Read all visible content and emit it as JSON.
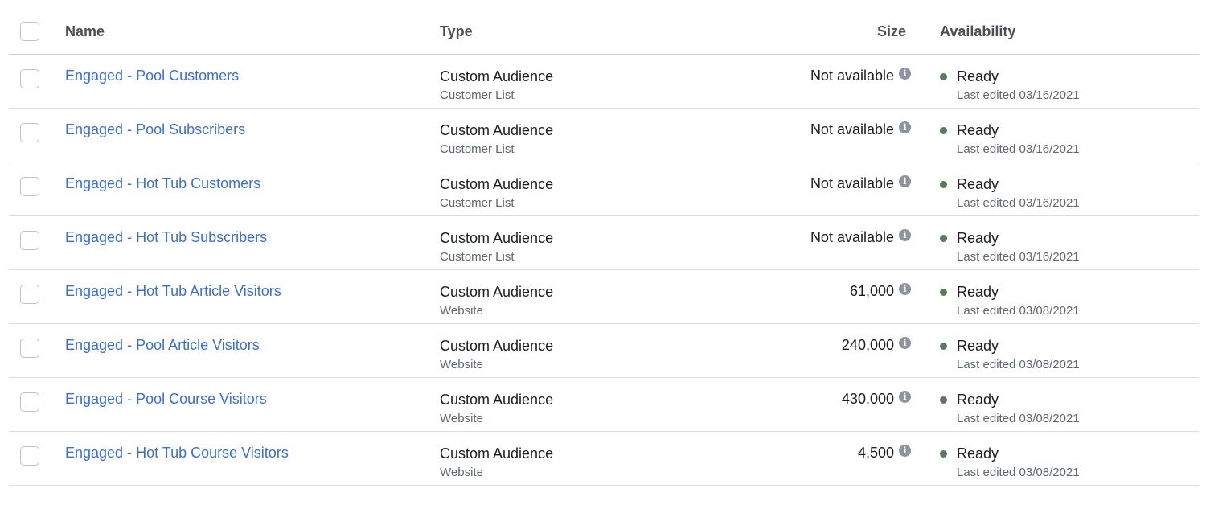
{
  "header": {
    "name_label": "Name",
    "type_label": "Type",
    "size_label": "Size",
    "availability_label": "Availability"
  },
  "colors": {
    "link": "#3b6fd6",
    "status_dot": "#5a7a5a",
    "divider": "#dadde1"
  },
  "rows": [
    {
      "name": "Engaged - Pool Customers",
      "type": "Custom Audience",
      "subtype": "Customer List",
      "size": "Not available",
      "status": "Ready",
      "edited": "Last edited 03/16/2021"
    },
    {
      "name": "Engaged - Pool Subscribers",
      "type": "Custom Audience",
      "subtype": "Customer List",
      "size": "Not available",
      "status": "Ready",
      "edited": "Last edited 03/16/2021"
    },
    {
      "name": "Engaged - Hot Tub Customers",
      "type": "Custom Audience",
      "subtype": "Customer List",
      "size": "Not available",
      "status": "Ready",
      "edited": "Last edited 03/16/2021"
    },
    {
      "name": "Engaged - Hot Tub Subscribers",
      "type": "Custom Audience",
      "subtype": "Customer List",
      "size": "Not available",
      "status": "Ready",
      "edited": "Last edited 03/16/2021"
    },
    {
      "name": "Engaged - Hot Tub Article Visitors",
      "type": "Custom Audience",
      "subtype": "Website",
      "size": "61,000",
      "status": "Ready",
      "edited": "Last edited 03/08/2021"
    },
    {
      "name": "Engaged - Pool Article Visitors",
      "type": "Custom Audience",
      "subtype": "Website",
      "size": "240,000",
      "status": "Ready",
      "edited": "Last edited 03/08/2021"
    },
    {
      "name": "Engaged - Pool Course Visitors",
      "type": "Custom Audience",
      "subtype": "Website",
      "size": "430,000",
      "status": "Ready",
      "edited": "Last edited 03/08/2021"
    },
    {
      "name": "Engaged - Hot Tub Course Visitors",
      "type": "Custom Audience",
      "subtype": "Website",
      "size": "4,500",
      "status": "Ready",
      "edited": "Last edited 03/08/2021"
    }
  ]
}
